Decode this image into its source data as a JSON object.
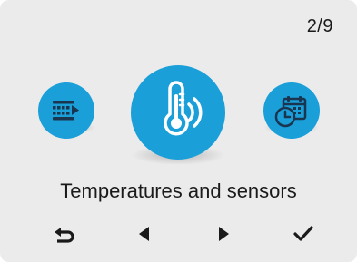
{
  "header": {
    "page_counter": "2/9"
  },
  "menu": {
    "items": [
      {
        "icon": "list-transfer-icon",
        "label": ""
      },
      {
        "icon": "thermometer-sensor-icon",
        "label": "Temperatures and sensors",
        "selected": true
      },
      {
        "icon": "calendar-clock-icon",
        "label": ""
      }
    ],
    "selected_title": "Temperatures and sensors"
  },
  "nav": {
    "buttons": [
      "back-icon",
      "previous-icon",
      "next-icon",
      "confirm-icon"
    ]
  },
  "colors": {
    "accent": "#1a9fd9",
    "background": "#ebebeb",
    "text": "#1a1a1a"
  }
}
